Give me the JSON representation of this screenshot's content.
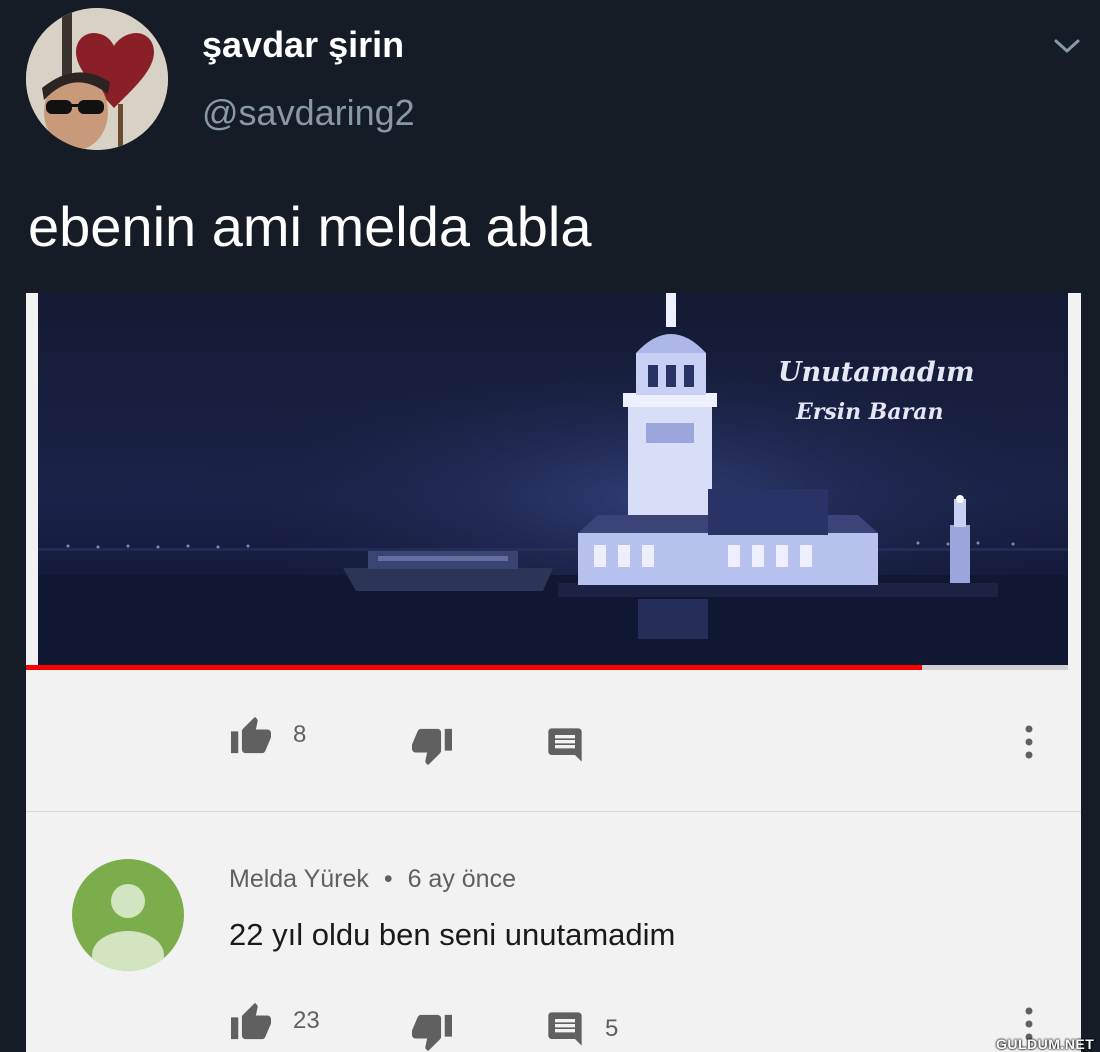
{
  "tweet": {
    "display_name": "şavdar şirin",
    "handle": "@savdaring2",
    "text": "ebenin ami melda abla"
  },
  "video": {
    "title": "Unutamadım",
    "artist": "Ersin Baran",
    "progress": 0.86,
    "accent": "#ff0000"
  },
  "video_actions": {
    "likes": "8",
    "icons": [
      "thumbs-up-icon",
      "thumbs-down-icon",
      "comment-icon",
      "more-vert-icon"
    ]
  },
  "comment": {
    "author": "Melda Yürek",
    "separator": "•",
    "time": "6 ay önce",
    "text": "22 yıl oldu ben seni unutamadim",
    "likes": "23",
    "replies": "5",
    "avatar_color": "#7bad4a"
  },
  "watermark": "GULDUM.NET"
}
